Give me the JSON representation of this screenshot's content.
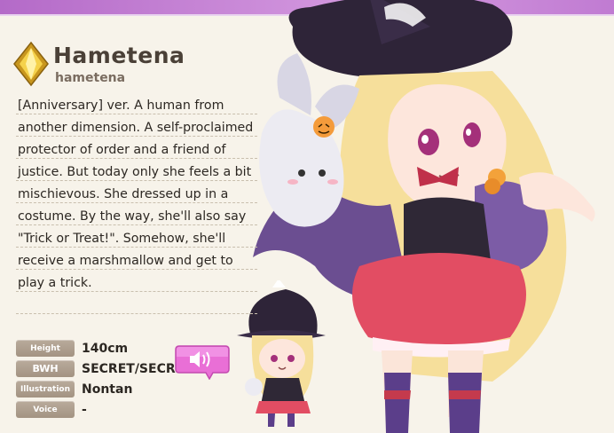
{
  "character": {
    "name": "Hametena",
    "reading": "hametena",
    "description": "[Anniversary] ver. A human from another dimension. A self-proclaimed protector of order and a friend of justice. But today only she feels a bit mischievous. She dressed up in a costume. By the way, she'll also say \"Trick or Treat!\". Somehow, she'll receive a marshmallow and get to play a trick.",
    "rarity_icon": "gold-diamond-gem-icon"
  },
  "stats": [
    {
      "label": "Height",
      "value": "140cm"
    },
    {
      "label": "BWH",
      "value": "SECRET/SECR"
    },
    {
      "label": "Illustration",
      "value": "Nontan"
    },
    {
      "label": "Voice",
      "value": "-"
    }
  ],
  "voice_button": {
    "icon": "speaker-icon"
  },
  "colors": {
    "accent_purple": "#b46ac8",
    "label_bg": "#a89886",
    "voice_button_pink": "#e96fd6",
    "background": "#f7f3ea"
  }
}
